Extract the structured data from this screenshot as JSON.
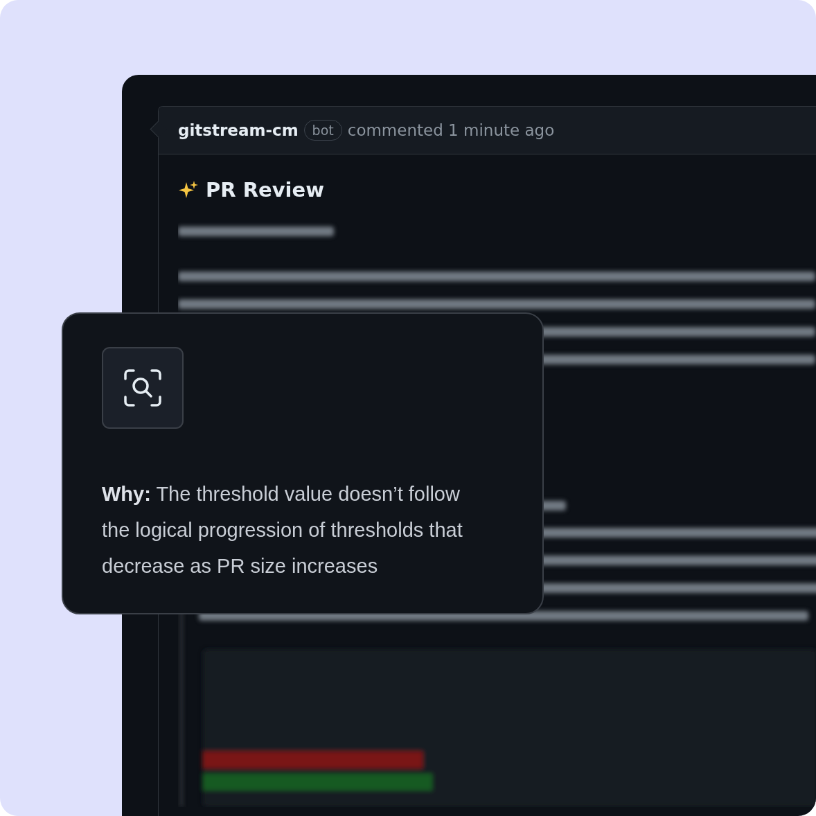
{
  "comment": {
    "author": "gitstream-cm",
    "badge": "bot",
    "action": "commented 1 minute ago",
    "heading": "PR Review"
  },
  "callout": {
    "text": "**Why:** The threshold value doesn’t follow the logical progression of thresholds that decrease as PR size increases"
  }
}
